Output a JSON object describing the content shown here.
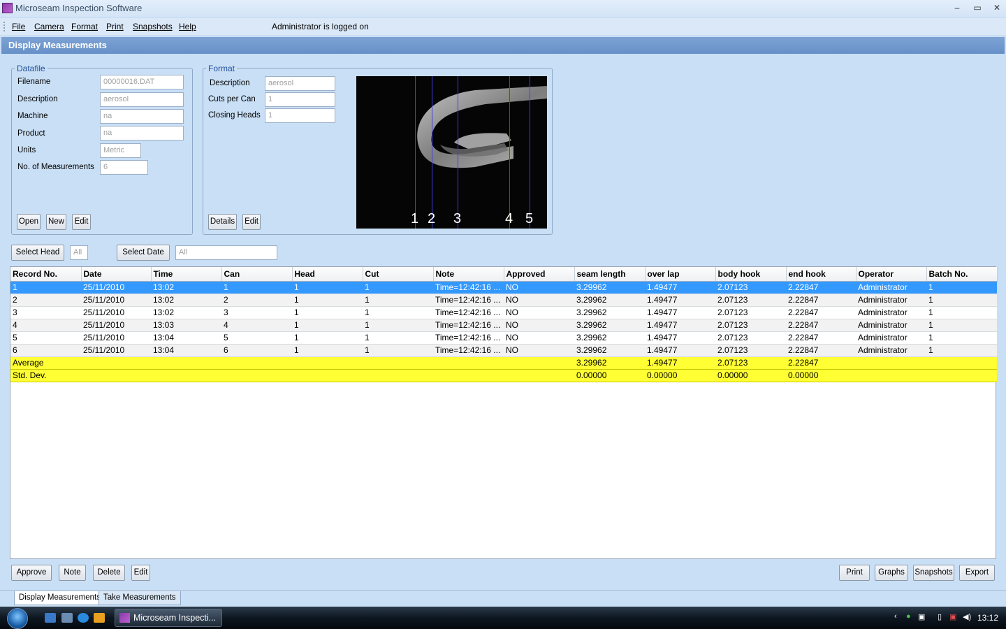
{
  "window": {
    "title": "Microseam Inspection Software",
    "minimize": "–",
    "maximize": "▭",
    "close": "✕"
  },
  "menu": {
    "items": [
      "File",
      "Camera",
      "Format",
      "Print",
      "Snapshots",
      "Help"
    ],
    "status": "Administrator is logged on"
  },
  "header": {
    "title": "Display Measurements"
  },
  "datafile": {
    "legend": "Datafile",
    "filename_label": "Filename",
    "filename": "00000016.DAT",
    "description_label": "Description",
    "description": "aerosol",
    "machine_label": "Machine",
    "machine": "na",
    "product_label": "Product",
    "product": "na",
    "units_label": "Units",
    "units": "Metric",
    "measurements_label": "No. of Measurements",
    "measurements": "6",
    "buttons": {
      "open": "Open",
      "new": "New",
      "edit": "Edit"
    }
  },
  "format": {
    "legend": "Format",
    "description_label": "Description",
    "description": "aerosol",
    "cuts_label": "Cuts per Can",
    "cuts": "1",
    "heads_label": "Closing Heads",
    "heads": "1",
    "buttons": {
      "details": "Details",
      "edit": "Edit"
    },
    "image_numbers": [
      "1",
      "2",
      "3",
      "4",
      "5"
    ]
  },
  "filters": {
    "select_head": "Select Head",
    "head_value": "All",
    "select_date": "Select Date",
    "date_value": "All"
  },
  "table": {
    "columns": [
      "Record No.",
      "Date",
      "Time",
      "Can",
      "Head",
      "Cut",
      "Note",
      "Approved",
      "seam length",
      "over lap",
      "body hook",
      "end hook",
      "Operator",
      "Batch No."
    ],
    "rows": [
      [
        "1",
        "25/11/2010",
        "13:02",
        "1",
        "1",
        "1",
        "Time=12:42:16 ...",
        "NO",
        "3.29962",
        "1.49477",
        "2.07123",
        "2.22847",
        "Administrator",
        "1"
      ],
      [
        "2",
        "25/11/2010",
        "13:02",
        "2",
        "1",
        "1",
        "Time=12:42:16 ...",
        "NO",
        "3.29962",
        "1.49477",
        "2.07123",
        "2.22847",
        "Administrator",
        "1"
      ],
      [
        "3",
        "25/11/2010",
        "13:02",
        "3",
        "1",
        "1",
        "Time=12:42:16 ...",
        "NO",
        "3.29962",
        "1.49477",
        "2.07123",
        "2.22847",
        "Administrator",
        "1"
      ],
      [
        "4",
        "25/11/2010",
        "13:03",
        "4",
        "1",
        "1",
        "Time=12:42:16 ...",
        "NO",
        "3.29962",
        "1.49477",
        "2.07123",
        "2.22847",
        "Administrator",
        "1"
      ],
      [
        "5",
        "25/11/2010",
        "13:04",
        "5",
        "1",
        "1",
        "Time=12:42:16 ...",
        "NO",
        "3.29962",
        "1.49477",
        "2.07123",
        "2.22847",
        "Administrator",
        "1"
      ],
      [
        "6",
        "25/11/2010",
        "13:04",
        "6",
        "1",
        "1",
        "Time=12:42:16 ...",
        "NO",
        "3.29962",
        "1.49477",
        "2.07123",
        "2.22847",
        "Administrator",
        "1"
      ]
    ],
    "summary": [
      [
        "Average",
        "",
        "",
        "",
        "",
        "",
        "",
        "",
        "3.29962",
        "1.49477",
        "2.07123",
        "2.22847",
        "",
        ""
      ],
      [
        "Std. Dev.",
        "",
        "",
        "",
        "",
        "",
        "",
        "",
        "0.00000",
        "0.00000",
        "0.00000",
        "0.00000",
        "",
        ""
      ]
    ],
    "selected_row": 0,
    "selected_color": "#3399ff",
    "summary_color": "#ffff33"
  },
  "bottom_buttons": {
    "approve": "Approve",
    "note": "Note",
    "delete": "Delete",
    "edit": "Edit",
    "print": "Print",
    "graphs": "Graphs",
    "snapshots": "Snapshots",
    "export": "Export"
  },
  "tabs": {
    "display": "Display Measurements",
    "take": "Take Measurements"
  },
  "taskbar": {
    "app_button": "Microseam Inspecti...",
    "clock": "13:12"
  },
  "colors": {
    "background": "#c9dff5",
    "header": "#6690c8",
    "group_label": "#1f4f9a"
  }
}
